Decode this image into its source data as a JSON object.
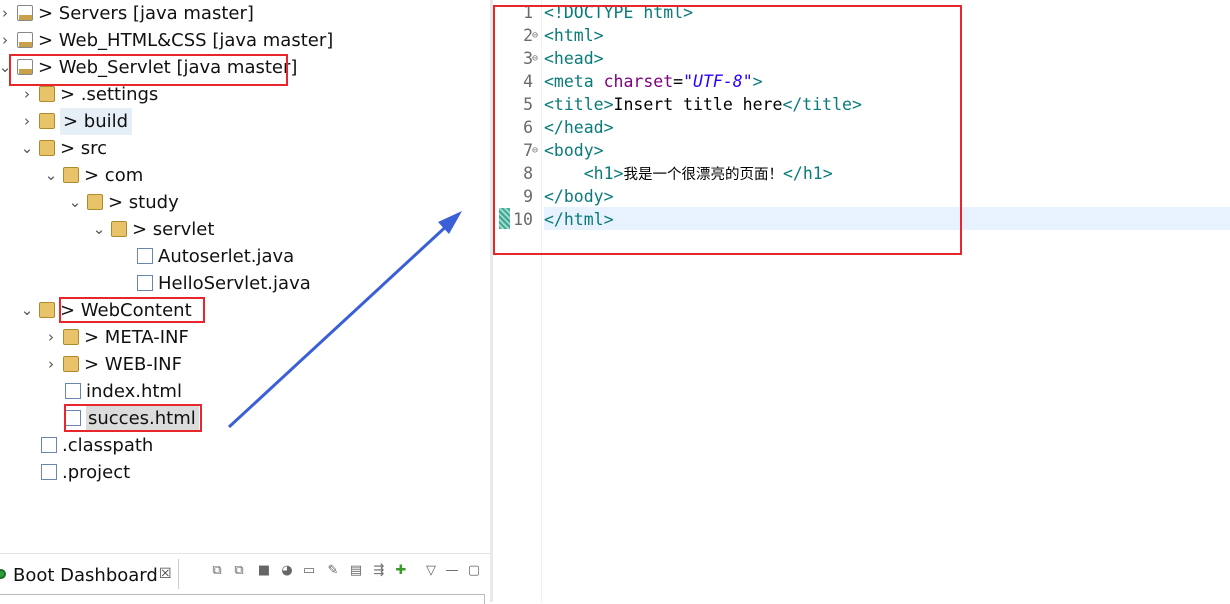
{
  "explorer": {
    "items": [
      {
        "chevron": "›",
        "icon": "project-icon",
        "label": "> Servers [java master]"
      },
      {
        "chevron": "›",
        "icon": "project-icon",
        "label": "> Web_HTML&CSS [java master]"
      },
      {
        "chevron": "⌄",
        "icon": "project-icon",
        "label": "> Web_Servlet [java master]"
      },
      {
        "chevron": "›",
        "icon": "folder-icon",
        "label": "> .settings"
      },
      {
        "chevron": "›",
        "icon": "folder-icon",
        "label": "> build"
      },
      {
        "chevron": "⌄",
        "icon": "folder-icon",
        "label": "> src"
      },
      {
        "chevron": "⌄",
        "icon": "package-icon",
        "label": "> com"
      },
      {
        "chevron": "⌄",
        "icon": "package-icon",
        "label": "> study"
      },
      {
        "chevron": "⌄",
        "icon": "package-icon",
        "label": "> servlet"
      },
      {
        "chevron": "",
        "icon": "java-file-icon",
        "label": "Autoserlet.java"
      },
      {
        "chevron": "",
        "icon": "java-file-icon",
        "label": "HelloServlet.java"
      },
      {
        "chevron": "⌄",
        "icon": "folder-icon",
        "label": "> WebContent"
      },
      {
        "chevron": "›",
        "icon": "folder-icon",
        "label": "> META-INF"
      },
      {
        "chevron": "›",
        "icon": "folder-icon",
        "label": "> WEB-INF"
      },
      {
        "chevron": "",
        "icon": "html-file-icon",
        "label": "index.html"
      },
      {
        "chevron": "",
        "icon": "html-file-icon",
        "label": "succes.html"
      },
      {
        "chevron": "",
        "icon": "xml-file-icon",
        "label": ".classpath"
      },
      {
        "chevron": "",
        "icon": "xml-file-icon",
        "label": ".project"
      }
    ]
  },
  "editor": {
    "lines": [
      {
        "n": "1",
        "fold": "",
        "parts": [
          [
            "tag",
            "<!DOCTYPE html>"
          ]
        ]
      },
      {
        "n": "2",
        "fold": "⊖",
        "parts": [
          [
            "tag",
            "<html>"
          ]
        ]
      },
      {
        "n": "3",
        "fold": "⊖",
        "parts": [
          [
            "tag",
            "<head>"
          ]
        ]
      },
      {
        "n": "4",
        "fold": "",
        "parts": [
          [
            "tag",
            "<meta "
          ],
          [
            "attr",
            "charset"
          ],
          [
            "txt",
            "="
          ],
          [
            "str",
            "\"UTF-8\""
          ],
          [
            "tag",
            ">"
          ]
        ]
      },
      {
        "n": "5",
        "fold": "",
        "parts": [
          [
            "tag",
            "<title>"
          ],
          [
            "txt",
            "Insert title here"
          ],
          [
            "tag",
            "</title>"
          ]
        ]
      },
      {
        "n": "6",
        "fold": "",
        "parts": [
          [
            "tag",
            "</head>"
          ]
        ]
      },
      {
        "n": "7",
        "fold": "⊖",
        "parts": [
          [
            "tag",
            "<body>"
          ]
        ]
      },
      {
        "n": "8",
        "fold": "",
        "parts": [
          [
            "txt",
            "    "
          ],
          [
            "tag",
            "<h1>"
          ],
          [
            "cn",
            "我是一个很漂亮的页面！"
          ],
          [
            "tag",
            "</h1>"
          ]
        ]
      },
      {
        "n": "9",
        "fold": "",
        "parts": [
          [
            "tag",
            "</body>"
          ]
        ]
      },
      {
        "n": "10",
        "fold": "",
        "parts": [
          [
            "tag",
            "</html>"
          ]
        ]
      }
    ]
  },
  "dashboard": {
    "tab_label": "Boot Dashboard",
    "close_glyph": "☒",
    "toolbar": [
      "⧉",
      "⧉",
      "■",
      "◕",
      "▭",
      "✎",
      "▤",
      "⇶",
      "✚",
      "▽",
      "—",
      "▢"
    ]
  },
  "colors": {
    "annotation_red": "#e8262b",
    "arrow_blue": "#3b5fd6",
    "tag_teal": "#0a7a7a",
    "attr_purple": "#7f007f",
    "string_blue": "#2a00ff"
  }
}
